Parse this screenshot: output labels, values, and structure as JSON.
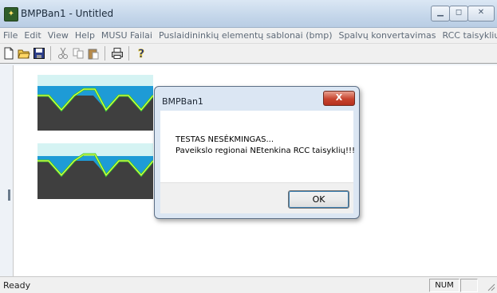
{
  "window": {
    "title": "BMPBan1 - Untitled",
    "app_icon": "app-icon",
    "controls": [
      "minimize-icon",
      "maximize-icon",
      "close-icon"
    ]
  },
  "menu": {
    "items": [
      {
        "label": "File"
      },
      {
        "label": "Edit"
      },
      {
        "label": "View"
      },
      {
        "label": "Help"
      },
      {
        "label": "MUSU Failai"
      },
      {
        "label": "Puslaidininkių elementų sablonai (bmp)"
      },
      {
        "label": "Spalvų konvertavimas"
      },
      {
        "label": "RCC taisyklių taikymas"
      }
    ]
  },
  "toolbar": {
    "buttons": [
      "new-icon",
      "open-icon",
      "save-icon",
      "cut-icon",
      "copy-icon",
      "paste-icon",
      "print-icon",
      "help-icon"
    ]
  },
  "dialog": {
    "title": "BMPBan1",
    "close_label": "X",
    "message_line1": "TESTAS NESĖKMINGAS...",
    "message_line2": "Paveikslo regionai NEtenkina RCC taisyklių!!!",
    "ok_label": "OK"
  },
  "status": {
    "text": "Ready",
    "num_indicator": "NUM"
  },
  "colors": {
    "water": "#1e9bd6",
    "light_cyan": "#d5f3f3",
    "dark_gray": "#3f3f3f",
    "yellow_green_outline": "#aef04a",
    "green_outline": "#36c53a"
  }
}
